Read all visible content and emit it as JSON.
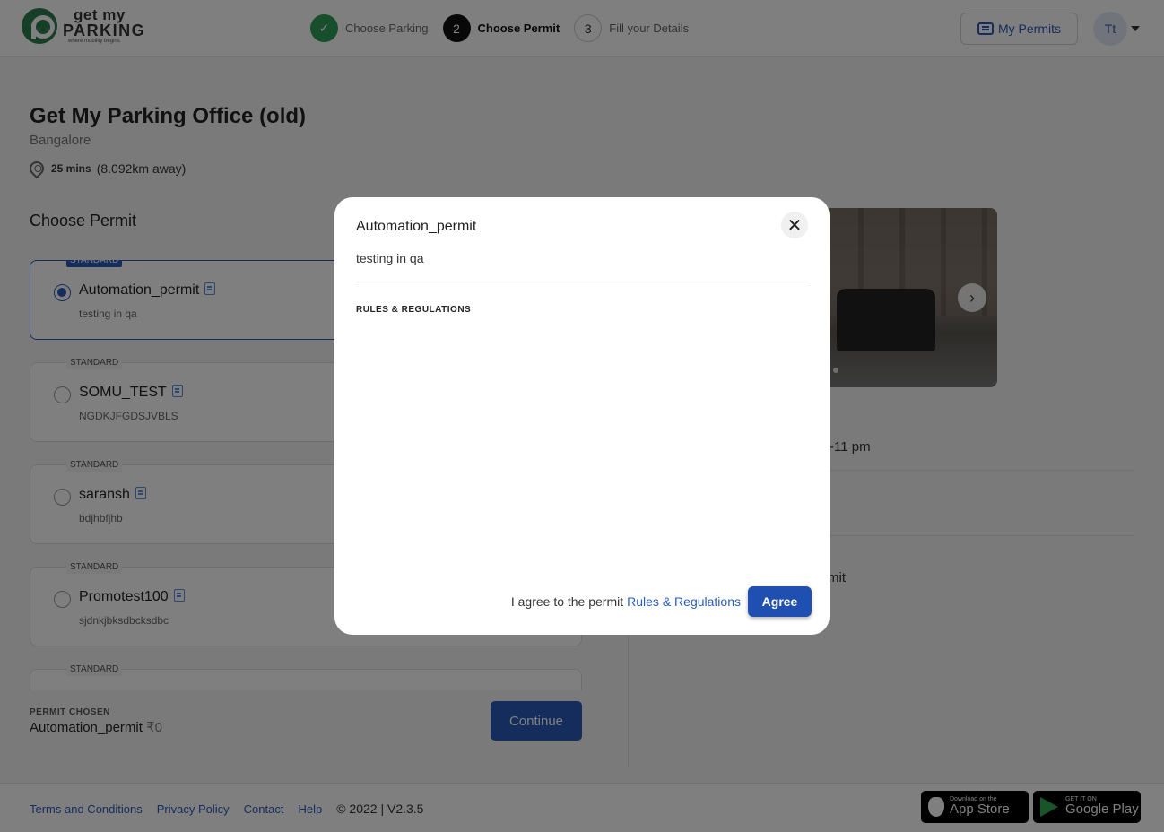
{
  "header": {
    "logo": {
      "line1": "get my",
      "line2": "PARKING",
      "tagline": "where mobility begins"
    },
    "steps": [
      {
        "number": "✓",
        "label": "Choose Parking",
        "state": "done"
      },
      {
        "number": "2",
        "label": "Choose Permit",
        "state": "active"
      },
      {
        "number": "3",
        "label": "Fill your Details",
        "state": "pending"
      }
    ],
    "my_permits_label": "My Permits",
    "avatar_initials": "Tt"
  },
  "location": {
    "title": "Get My Parking Office (old)",
    "city": "Bangalore",
    "travel_time": "25 mins",
    "distance": "(8.092km away)"
  },
  "permits": {
    "heading": "Choose Permit",
    "items": [
      {
        "badge": "STANDARD",
        "name": "Automation_permit",
        "desc": "testing in qa",
        "selected": true
      },
      {
        "badge": "STANDARD",
        "name": "SOMU_TEST",
        "desc": "NGDKJFGDSJVBLS",
        "selected": false
      },
      {
        "badge": "STANDARD",
        "name": "saransh",
        "desc": "bdjhbfjhb",
        "selected": false
      },
      {
        "badge": "STANDARD",
        "name": "Promotest100",
        "desc": "sjdnkjbksdbcksdbc",
        "selected": false
      },
      {
        "badge": "STANDARD",
        "name": "",
        "desc": "",
        "selected": false
      }
    ]
  },
  "chosen": {
    "label": "PERMIT CHOSEN",
    "name": "Automation_permit",
    "price": "₹0",
    "continue_label": "Continue"
  },
  "right_panel": {
    "hours_fragment": "-11 pm",
    "permit_fragment": "rmit"
  },
  "footer": {
    "links": [
      "Terms and Conditions",
      "Privacy Policy",
      "Contact",
      "Help"
    ],
    "copyright": "© 2022 | V2.3.5",
    "app_store": {
      "small": "Download on the",
      "big": "App Store"
    },
    "google_play": {
      "small": "GET IT ON",
      "big": "Google Play"
    }
  },
  "modal": {
    "title": "Automation_permit",
    "description": "testing in qa",
    "rules_heading": "RULES & REGULATIONS",
    "agree_text": "I agree to the permit",
    "agree_link": "Rules & Regulations",
    "agree_button": "Agree"
  },
  "colors": {
    "primary": "#2a5bb8",
    "success": "#2e9e5b",
    "brand_green": "#2e7d4f"
  }
}
